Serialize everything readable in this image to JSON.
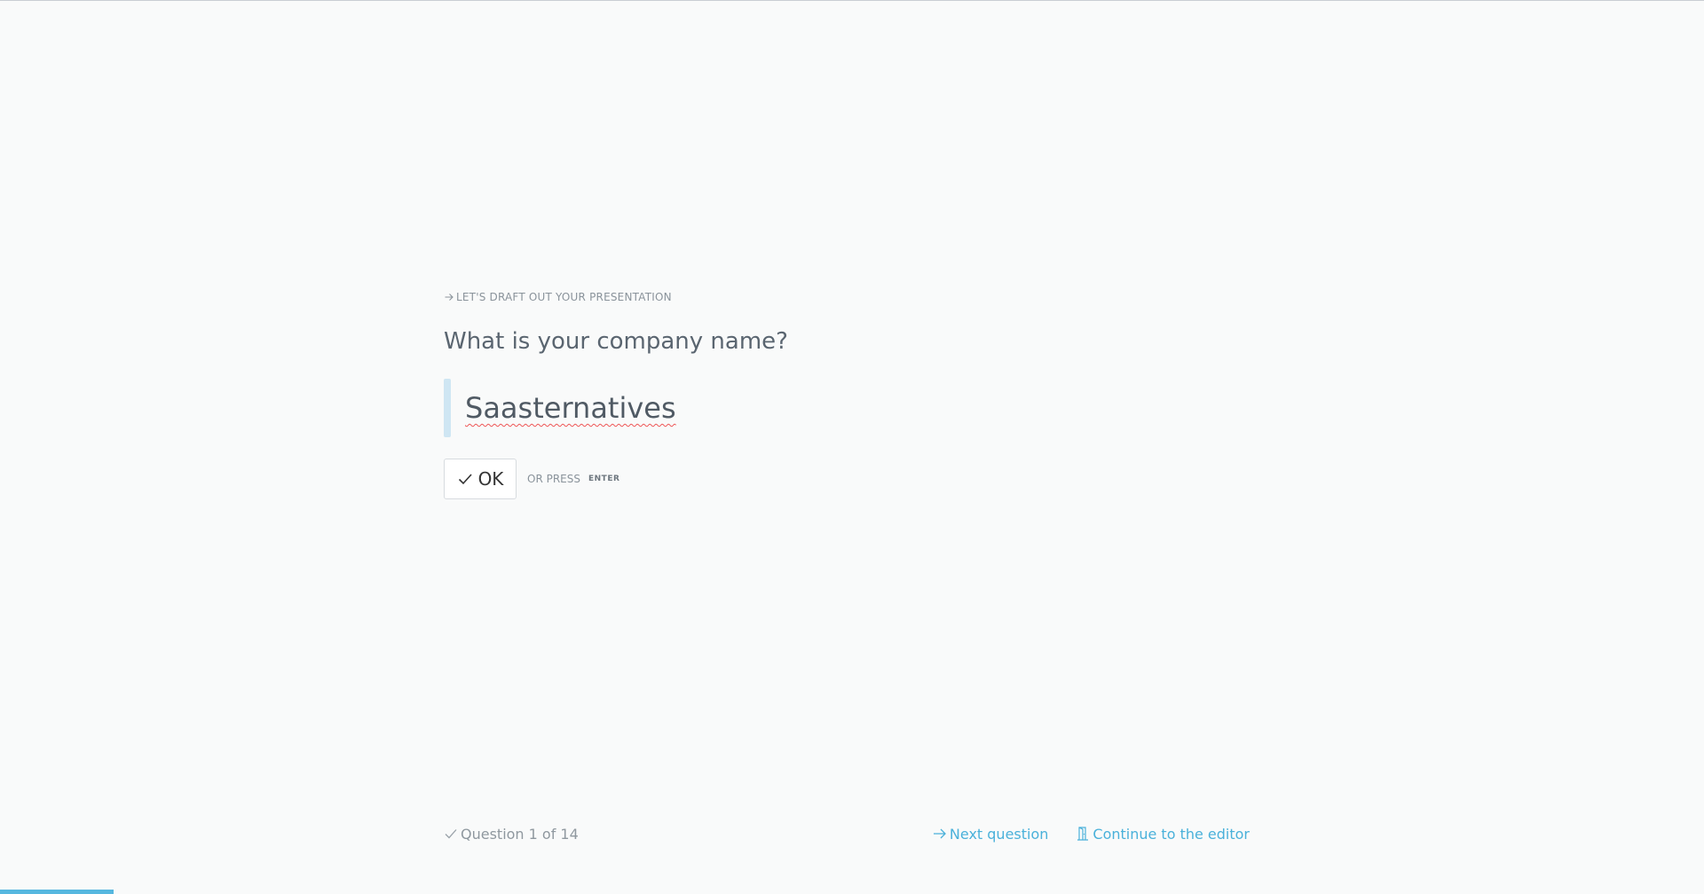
{
  "section": {
    "label": "Let's draft out your presentation",
    "icon": "arrow-right-icon"
  },
  "question": {
    "title": "What is your company name?",
    "answer_value": "Saasternatives"
  },
  "actions": {
    "ok_label": "OK",
    "ok_icon": "check-icon",
    "hint_prefix": "or press",
    "hint_key": "Enter"
  },
  "footer": {
    "progress_label": "Question 1 of 14",
    "progress_icon": "check-icon",
    "next_label": "Next question",
    "next_icon": "arrow-right-icon",
    "editor_label": "Continue to the editor",
    "editor_icon": "door-icon"
  },
  "progress": {
    "current": 1,
    "total": 14,
    "fraction": 0.0667
  },
  "colors": {
    "accent": "#4ab1da",
    "progress_bar": "#56b7df",
    "answer_bar": "#cfe6f3",
    "background": "#f9fafa"
  }
}
